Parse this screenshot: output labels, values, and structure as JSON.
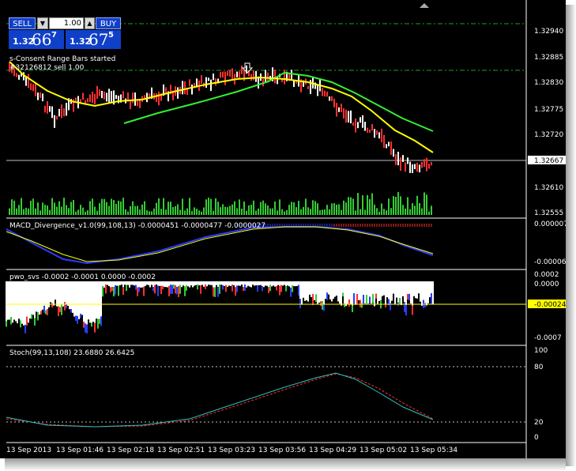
{
  "trade_panel": {
    "sell_label": "SELL",
    "buy_label": "BUY",
    "lot_value": "1.00",
    "sell_price": {
      "small": "1.32",
      "big": "66",
      "sup": "7"
    },
    "buy_price": {
      "small": "1.32",
      "big": "67",
      "sup": "5"
    }
  },
  "main_chart": {
    "notes": [
      "s-Consent Range Bars started",
      "#32126812 sell 1.00"
    ],
    "price_axis": [
      "1.32940",
      "1.32885",
      "1.32830",
      "1.32775",
      "1.32720",
      "1.32610",
      "1.32555"
    ],
    "current_price": "1.32667"
  },
  "macd_panel": {
    "label": "MACD_Divergence_v1.0(99,108,13) -0.0000451 -0.0000477 -0.0000027",
    "axis": [
      "0.0000073",
      "-0.000062"
    ]
  },
  "pwo_panel": {
    "label": "pwo_svs -0.0002 -0.0001 0.0000 -0.0002",
    "axis": [
      "0.0002",
      "0.0000",
      "-0.0007"
    ],
    "current_value": "-0.00024"
  },
  "stoch_panel": {
    "label": "Stoch(99,13,108) 23.6880 26.6425",
    "axis": [
      "100",
      "80",
      "20",
      "0"
    ]
  },
  "time_axis": [
    "13 Sep 2013",
    "13 Sep 01:46",
    "13 Sep 02:18",
    "13 Sep 02:51",
    "13 Sep 03:23",
    "13 Sep 03:56",
    "13 Sep 04:29",
    "13 Sep 05:02",
    "13 Sep 05:34"
  ],
  "colors": {
    "background": "#000000",
    "bull_bar": "#ffffff",
    "bear_bar": "#ff3030",
    "ma_fast": "#ffff00",
    "ma_slow": "#33ee33",
    "volume": "#33cc33",
    "macd_main": "#2a3cff",
    "macd_signal": "#ffff00",
    "pwo_fill": "#ffffff",
    "stoch_main": "#30c0c0",
    "stoch_signal": "#ff3030",
    "level_line": "#20a020",
    "current_bg": "#ffff00"
  },
  "icons": {
    "sell_arrow": "down-arrow-icon"
  }
}
